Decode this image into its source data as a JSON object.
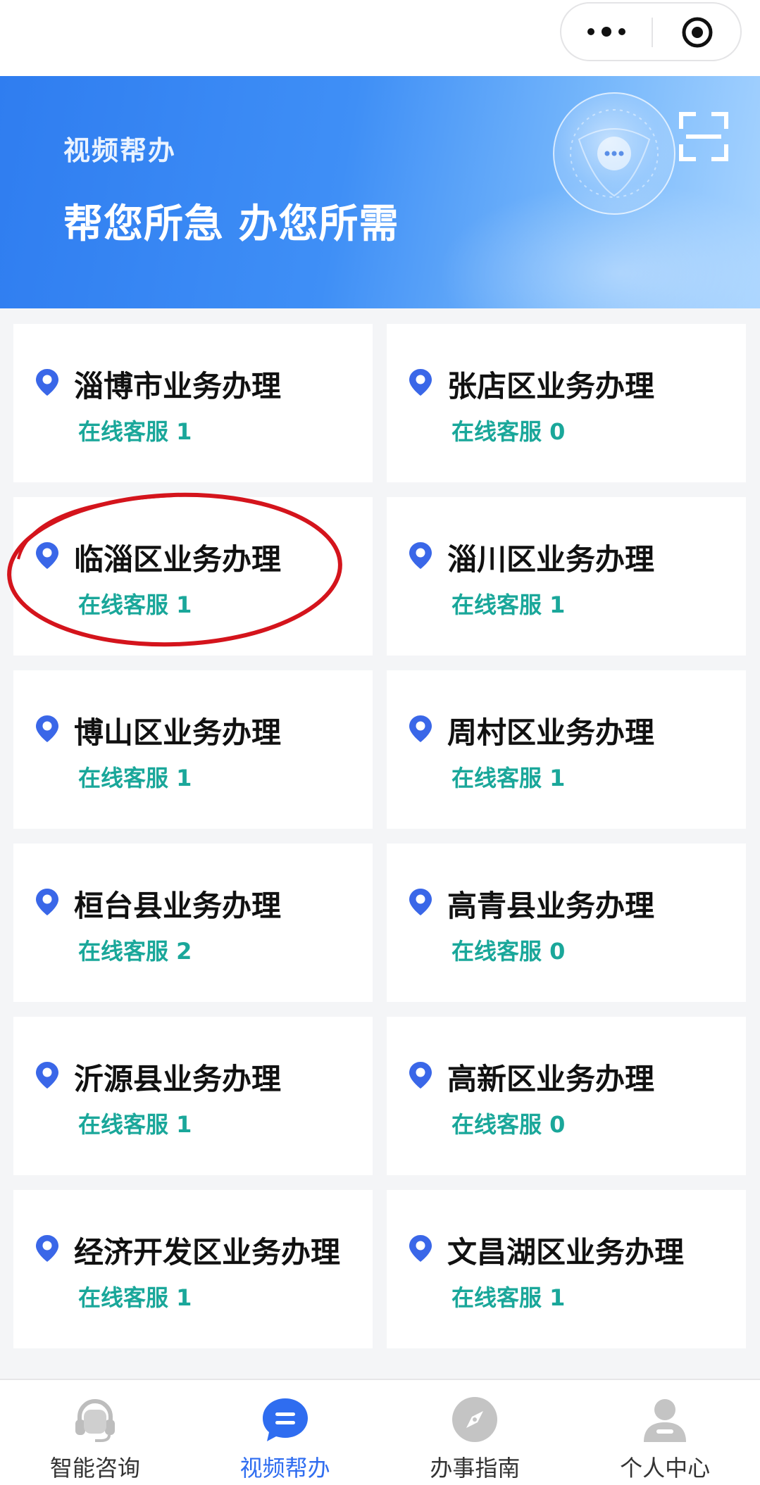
{
  "capsule": {
    "more_icon": "more-dots-icon",
    "close_icon": "target-close-icon"
  },
  "banner": {
    "subtitle": "视频帮办",
    "headline": "帮您所急 办您所需",
    "scan_icon": "scan-icon"
  },
  "services": [
    {
      "title": "淄博市业务办理",
      "online": "在线客服 1"
    },
    {
      "title": "张店区业务办理",
      "online": "在线客服 0"
    },
    {
      "title": "临淄区业务办理",
      "online": "在线客服 1"
    },
    {
      "title": "淄川区业务办理",
      "online": "在线客服 1"
    },
    {
      "title": "博山区业务办理",
      "online": "在线客服 1"
    },
    {
      "title": "周村区业务办理",
      "online": "在线客服 1"
    },
    {
      "title": "桓台县业务办理",
      "online": "在线客服 2"
    },
    {
      "title": "高青县业务办理",
      "online": "在线客服 0"
    },
    {
      "title": "沂源县业务办理",
      "online": "在线客服 1"
    },
    {
      "title": "高新区业务办理",
      "online": "在线客服 0"
    },
    {
      "title": "经济开发区业务办理",
      "online": "在线客服 1"
    },
    {
      "title": "文昌湖区业务办理",
      "online": "在线客服 1"
    }
  ],
  "tabs": [
    {
      "label": "智能咨询",
      "icon": "headset-icon",
      "active": false
    },
    {
      "label": "视频帮办",
      "icon": "chat-bubble-icon",
      "active": true
    },
    {
      "label": "办事指南",
      "icon": "compass-icon",
      "active": false
    },
    {
      "label": "个人中心",
      "icon": "person-icon",
      "active": false
    }
  ],
  "colors": {
    "accent": "#2f6df0",
    "online_text": "#1aa79a",
    "pin": "#3a67e8",
    "highlight": "#d4141c"
  }
}
